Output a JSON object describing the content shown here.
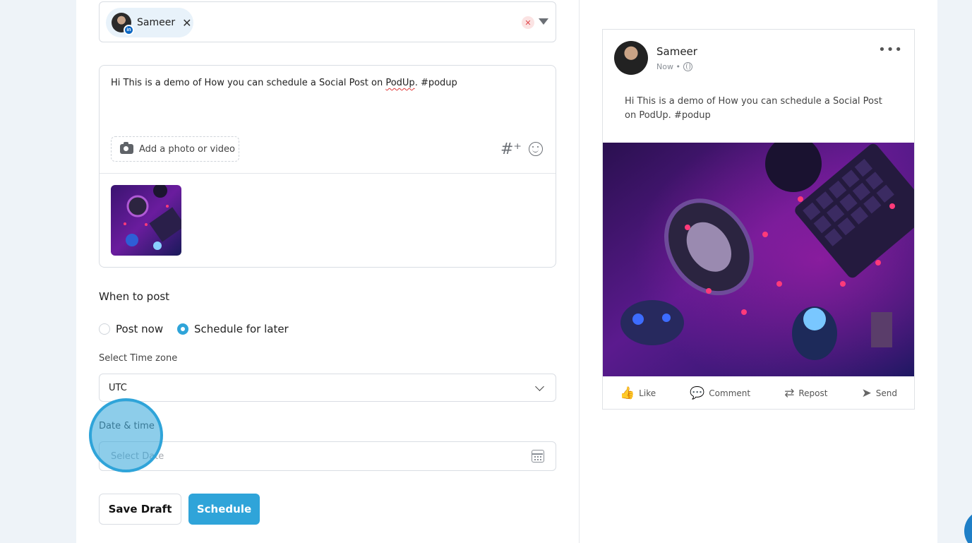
{
  "account": {
    "chip_name": "Sameer",
    "chip_remove": "✕",
    "network_badge": "in",
    "clear_icon": "✕"
  },
  "compose": {
    "text_before": "Hi This is a demo of How you can schedule a Social Post on ",
    "text_misspelled": "PodUp",
    "text_after": ". #podup",
    "add_media_label": "Add a photo or video",
    "hashtag_icon": "#⁺"
  },
  "schedule": {
    "heading": "When to post",
    "options": [
      {
        "label": "Post now",
        "selected": false
      },
      {
        "label": "Schedule for later",
        "selected": true
      }
    ],
    "timezone_label": "Select Time zone",
    "timezone_value": "UTC",
    "date_label": "Date & time",
    "date_placeholder": "Select Date"
  },
  "actions": {
    "save_draft": "Save Draft",
    "schedule": "Schedule"
  },
  "preview": {
    "name": "Sameer",
    "meta": "Now •",
    "more": "•••",
    "text": "Hi This is a demo of How you can schedule a Social Post on PodUp. #podup",
    "buttons": [
      {
        "label": "Like",
        "icon": "thumbs-up-icon",
        "glyph": "👍"
      },
      {
        "label": "Comment",
        "icon": "comment-icon",
        "glyph": "💬"
      },
      {
        "label": "Repost",
        "icon": "repost-icon",
        "glyph": "⇄"
      },
      {
        "label": "Send",
        "icon": "send-icon",
        "glyph": "➤"
      }
    ]
  },
  "colors": {
    "accent": "#2fa4d9",
    "linkedin": "#0a66c2",
    "error": "#e0474c"
  }
}
